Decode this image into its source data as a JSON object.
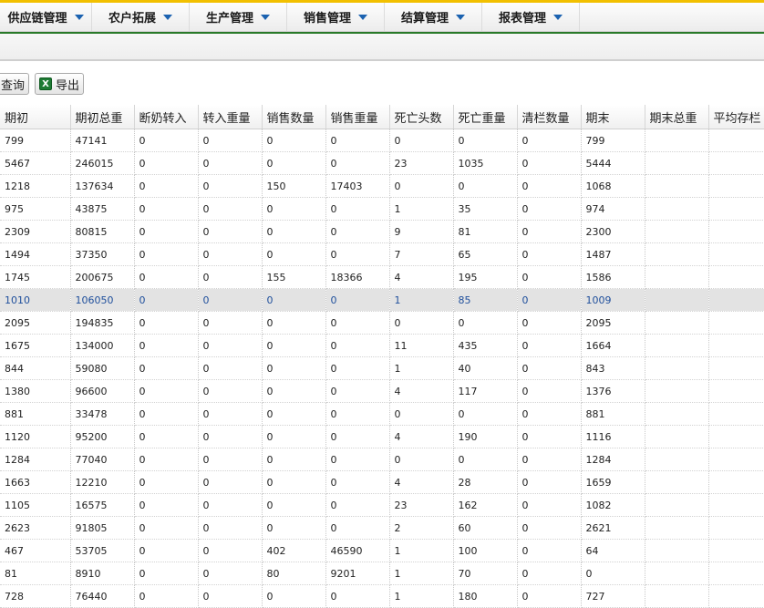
{
  "menu": [
    {
      "label": "供应链管理"
    },
    {
      "label": "农户拓展"
    },
    {
      "label": "生产管理"
    },
    {
      "label": "销售管理"
    },
    {
      "label": "结算管理"
    },
    {
      "label": "报表管理"
    }
  ],
  "toolbar": {
    "query_label": "查询",
    "export_label": "导出",
    "export_icon": "excel-icon"
  },
  "colors": {
    "accent_top": "#f2c000",
    "menu_caret": "#1b62b0",
    "selected_row_text": "#1f4f9c"
  },
  "table": {
    "columns": [
      "期初",
      "期初总重",
      "断奶转入",
      "转入重量",
      "销售数量",
      "销售重量",
      "死亡头数",
      "死亡重量",
      "清栏数量",
      "期末",
      "期末总重",
      "平均存栏"
    ],
    "selected_row_index": 7,
    "rows": [
      [
        "799",
        "47141",
        "0",
        "0",
        "0",
        "0",
        "0",
        "0",
        "0",
        "799",
        "",
        ""
      ],
      [
        "5467",
        "246015",
        "0",
        "0",
        "0",
        "0",
        "23",
        "1035",
        "0",
        "5444",
        "",
        ""
      ],
      [
        "1218",
        "137634",
        "0",
        "0",
        "150",
        "17403",
        "0",
        "0",
        "0",
        "1068",
        "",
        ""
      ],
      [
        "975",
        "43875",
        "0",
        "0",
        "0",
        "0",
        "1",
        "35",
        "0",
        "974",
        "",
        ""
      ],
      [
        "2309",
        "80815",
        "0",
        "0",
        "0",
        "0",
        "9",
        "81",
        "0",
        "2300",
        "",
        ""
      ],
      [
        "1494",
        "37350",
        "0",
        "0",
        "0",
        "0",
        "7",
        "65",
        "0",
        "1487",
        "",
        ""
      ],
      [
        "1745",
        "200675",
        "0",
        "0",
        "155",
        "18366",
        "4",
        "195",
        "0",
        "1586",
        "",
        ""
      ],
      [
        "1010",
        "106050",
        "0",
        "0",
        "0",
        "0",
        "1",
        "85",
        "0",
        "1009",
        "",
        ""
      ],
      [
        "2095",
        "194835",
        "0",
        "0",
        "0",
        "0",
        "0",
        "0",
        "0",
        "2095",
        "",
        ""
      ],
      [
        "1675",
        "134000",
        "0",
        "0",
        "0",
        "0",
        "11",
        "435",
        "0",
        "1664",
        "",
        ""
      ],
      [
        "844",
        "59080",
        "0",
        "0",
        "0",
        "0",
        "1",
        "40",
        "0",
        "843",
        "",
        ""
      ],
      [
        "1380",
        "96600",
        "0",
        "0",
        "0",
        "0",
        "4",
        "117",
        "0",
        "1376",
        "",
        ""
      ],
      [
        "881",
        "33478",
        "0",
        "0",
        "0",
        "0",
        "0",
        "0",
        "0",
        "881",
        "",
        ""
      ],
      [
        "1120",
        "95200",
        "0",
        "0",
        "0",
        "0",
        "4",
        "190",
        "0",
        "1116",
        "",
        ""
      ],
      [
        "1284",
        "77040",
        "0",
        "0",
        "0",
        "0",
        "0",
        "0",
        "0",
        "1284",
        "",
        ""
      ],
      [
        "1663",
        "12210",
        "0",
        "0",
        "0",
        "0",
        "4",
        "28",
        "0",
        "1659",
        "",
        ""
      ],
      [
        "1105",
        "16575",
        "0",
        "0",
        "0",
        "0",
        "23",
        "162",
        "0",
        "1082",
        "",
        ""
      ],
      [
        "2623",
        "91805",
        "0",
        "0",
        "0",
        "0",
        "2",
        "60",
        "0",
        "2621",
        "",
        ""
      ],
      [
        "467",
        "53705",
        "0",
        "0",
        "402",
        "46590",
        "1",
        "100",
        "0",
        "64",
        "",
        ""
      ],
      [
        "81",
        "8910",
        "0",
        "0",
        "80",
        "9201",
        "1",
        "70",
        "0",
        "0",
        "",
        ""
      ],
      [
        "728",
        "76440",
        "0",
        "0",
        "0",
        "0",
        "1",
        "180",
        "0",
        "727",
        "",
        ""
      ]
    ]
  }
}
